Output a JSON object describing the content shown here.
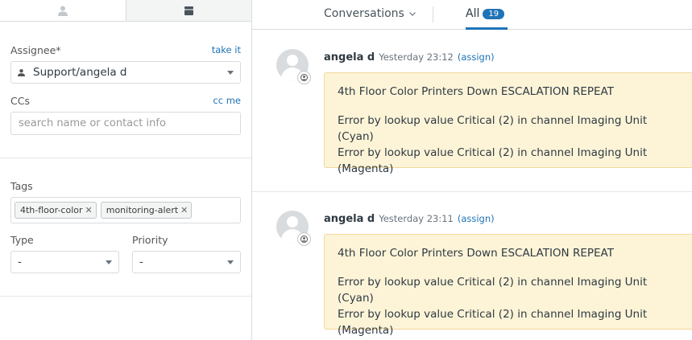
{
  "left": {
    "assignee": {
      "label": "Assignee*",
      "action": "take it",
      "value": "Support/angela d"
    },
    "ccs": {
      "label": "CCs",
      "action": "cc me",
      "placeholder": "search name or contact info"
    },
    "tags": {
      "label": "Tags",
      "items": [
        "4th-floor-color",
        "monitoring-alert"
      ]
    },
    "type": {
      "label": "Type",
      "value": "-"
    },
    "priority": {
      "label": "Priority",
      "value": "-"
    }
  },
  "top": {
    "conversations_label": "Conversations",
    "all_label": "All",
    "all_count": "19"
  },
  "comments": [
    {
      "author": "angela d",
      "time": "Yesterday 23:12",
      "assign": "(assign)",
      "subject": "4th Floor Color Printers Down ESCALATION REPEAT",
      "line1": "Error by lookup value Critical (2) in channel Imaging Unit (Cyan)",
      "line2": "Error by lookup value Critical (2) in channel Imaging Unit (Magenta)"
    },
    {
      "author": "angela d",
      "time": "Yesterday 23:11",
      "assign": "(assign)",
      "subject": "4th Floor Color Printers Down ESCALATION REPEAT",
      "line1": "Error by lookup value Critical (2) in channel Imaging Unit (Cyan)",
      "line2": "Error by lookup value Critical (2) in channel Imaging Unit (Magenta)"
    }
  ],
  "colors": {
    "accent": "#1f73b7",
    "note_bg": "#fdf4d8",
    "note_border": "#f3d79c"
  }
}
